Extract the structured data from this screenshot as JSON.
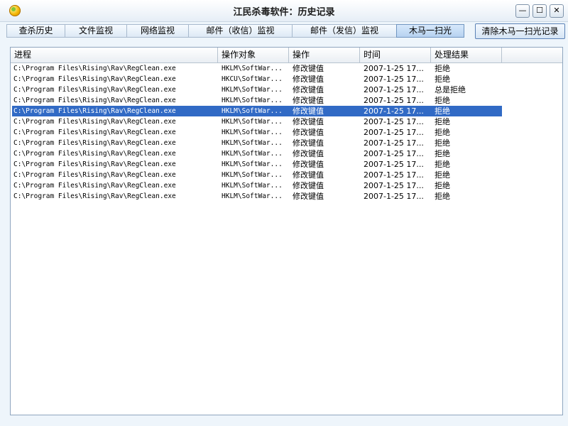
{
  "window": {
    "title": "江民杀毒软件：历史记录",
    "min_glyph": "—",
    "max_glyph": "☐",
    "close_glyph": "✕"
  },
  "tabs": [
    {
      "label": "查杀历史",
      "active": false
    },
    {
      "label": "文件监视",
      "active": false
    },
    {
      "label": "网络监视",
      "active": false
    },
    {
      "label": "邮件（收信）监视",
      "active": false
    },
    {
      "label": "邮件（发信）监视",
      "active": false
    },
    {
      "label": "木马一扫光",
      "active": true
    }
  ],
  "toolbar": {
    "clear_label": "清除木马一扫光记录"
  },
  "table": {
    "columns": [
      "进程",
      "操作对象",
      "操作",
      "时间",
      "处理结果"
    ],
    "selected_row": 4,
    "rows": [
      [
        "C:\\Program Files\\Rising\\Rav\\RegClean.exe",
        "HKLM\\SoftWar...",
        "修改键值",
        "2007-1-25 17...",
        "拒绝"
      ],
      [
        "C:\\Program Files\\Rising\\Rav\\RegClean.exe",
        "HKCU\\SoftWar...",
        "修改键值",
        "2007-1-25 17...",
        "拒绝"
      ],
      [
        "C:\\Program Files\\Rising\\Rav\\RegClean.exe",
        "HKLM\\SoftWar...",
        "修改键值",
        "2007-1-25 17...",
        "总是拒绝"
      ],
      [
        "C:\\Program Files\\Rising\\Rav\\RegClean.exe",
        "HKLM\\SoftWar...",
        "修改键值",
        "2007-1-25 17...",
        "拒绝"
      ],
      [
        "C:\\Program Files\\Rising\\Rav\\RegClean.exe",
        "HKLM\\SoftWar...",
        "修改键值",
        "2007-1-25 17...",
        "拒绝"
      ],
      [
        "C:\\Program Files\\Rising\\Rav\\RegClean.exe",
        "HKLM\\SoftWar...",
        "修改键值",
        "2007-1-25 17...",
        "拒绝"
      ],
      [
        "C:\\Program Files\\Rising\\Rav\\RegClean.exe",
        "HKLM\\SoftWar...",
        "修改键值",
        "2007-1-25 17...",
        "拒绝"
      ],
      [
        "C:\\Program Files\\Rising\\Rav\\RegClean.exe",
        "HKLM\\SoftWar...",
        "修改键值",
        "2007-1-25 17...",
        "拒绝"
      ],
      [
        "C:\\Program Files\\Rising\\Rav\\RegClean.exe",
        "HKLM\\SoftWar...",
        "修改键值",
        "2007-1-25 17...",
        "拒绝"
      ],
      [
        "C:\\Program Files\\Rising\\Rav\\RegClean.exe",
        "HKLM\\SoftWar...",
        "修改键值",
        "2007-1-25 17...",
        "拒绝"
      ],
      [
        "C:\\Program Files\\Rising\\Rav\\RegClean.exe",
        "HKLM\\SoftWar...",
        "修改键值",
        "2007-1-25 17...",
        "拒绝"
      ],
      [
        "C:\\Program Files\\Rising\\Rav\\RegClean.exe",
        "HKLM\\SoftWar...",
        "修改键值",
        "2007-1-25 17...",
        "拒绝"
      ],
      [
        "C:\\Program Files\\Rising\\Rav\\RegClean.exe",
        "HKLM\\SoftWar...",
        "修改键值",
        "2007-1-25 17...",
        "拒绝"
      ]
    ]
  }
}
